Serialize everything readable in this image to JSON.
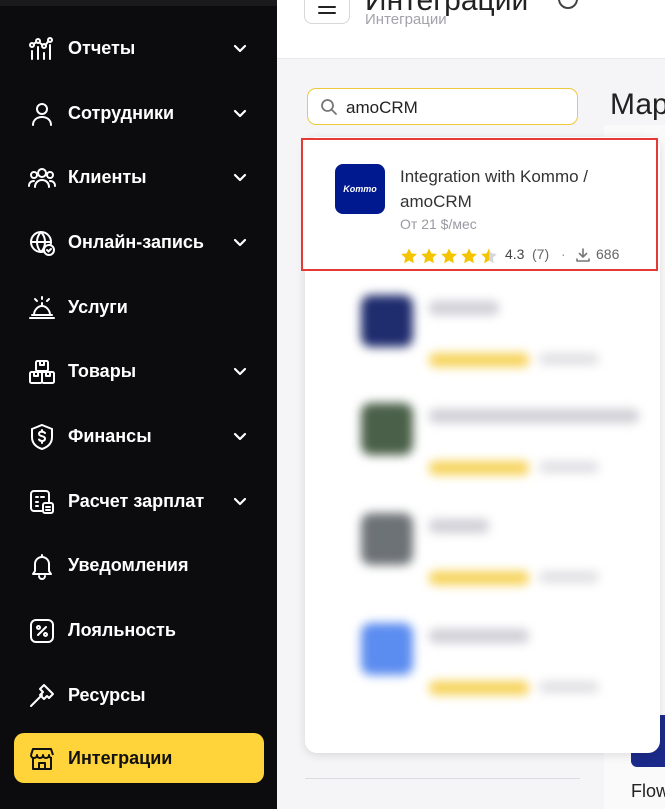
{
  "sidebar": {
    "items": [
      {
        "label": "Отчеты",
        "icon": "reports-icon",
        "has_chevron": true
      },
      {
        "label": "Сотрудники",
        "icon": "user-icon",
        "has_chevron": true
      },
      {
        "label": "Клиенты",
        "icon": "clients-icon",
        "has_chevron": true
      },
      {
        "label": "Онлайн-запись",
        "icon": "globe-icon",
        "has_chevron": true
      },
      {
        "label": "Услуги",
        "icon": "service-bell-icon",
        "has_chevron": false
      },
      {
        "label": "Товары",
        "icon": "boxes-icon",
        "has_chevron": true
      },
      {
        "label": "Финансы",
        "icon": "finance-icon",
        "has_chevron": true
      },
      {
        "label": "Расчет зарплат",
        "icon": "payroll-icon",
        "has_chevron": true
      },
      {
        "label": "Уведомления",
        "icon": "bell-icon",
        "has_chevron": false
      },
      {
        "label": "Лояльность",
        "icon": "percent-icon",
        "has_chevron": false
      },
      {
        "label": "Ресурсы",
        "icon": "hammer-icon",
        "has_chevron": false
      },
      {
        "label": "Интеграции",
        "icon": "store-icon",
        "has_chevron": false,
        "active": true
      }
    ]
  },
  "header": {
    "title": "Интеграции",
    "breadcrumb": "Интеграции"
  },
  "search": {
    "value": "amoCRM"
  },
  "market_title": "Мар",
  "result": {
    "logo_text": "Kommo",
    "title": "Integration with Kommo / amoCRM",
    "price": "От 21 $/мес",
    "stars": 4.3,
    "rating": "4.3",
    "reviews": "(7)",
    "separator": "·",
    "downloads": "686"
  },
  "right_panel": {
    "flow_text": "Flow"
  },
  "colors": {
    "sidebar_bg": "#0c0c0e",
    "active_bg": "#ffd43a",
    "accent_yellow": "#f0c93a",
    "highlight_red": "#e53935",
    "kommo_blue": "#00198f"
  }
}
